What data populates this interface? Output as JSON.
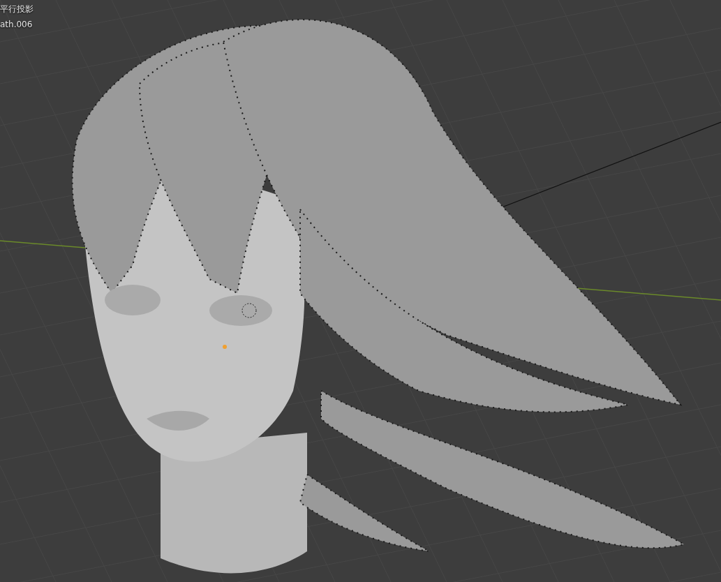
{
  "viewport": {
    "projection_label": "平行投影",
    "object_name": "ath.006"
  }
}
